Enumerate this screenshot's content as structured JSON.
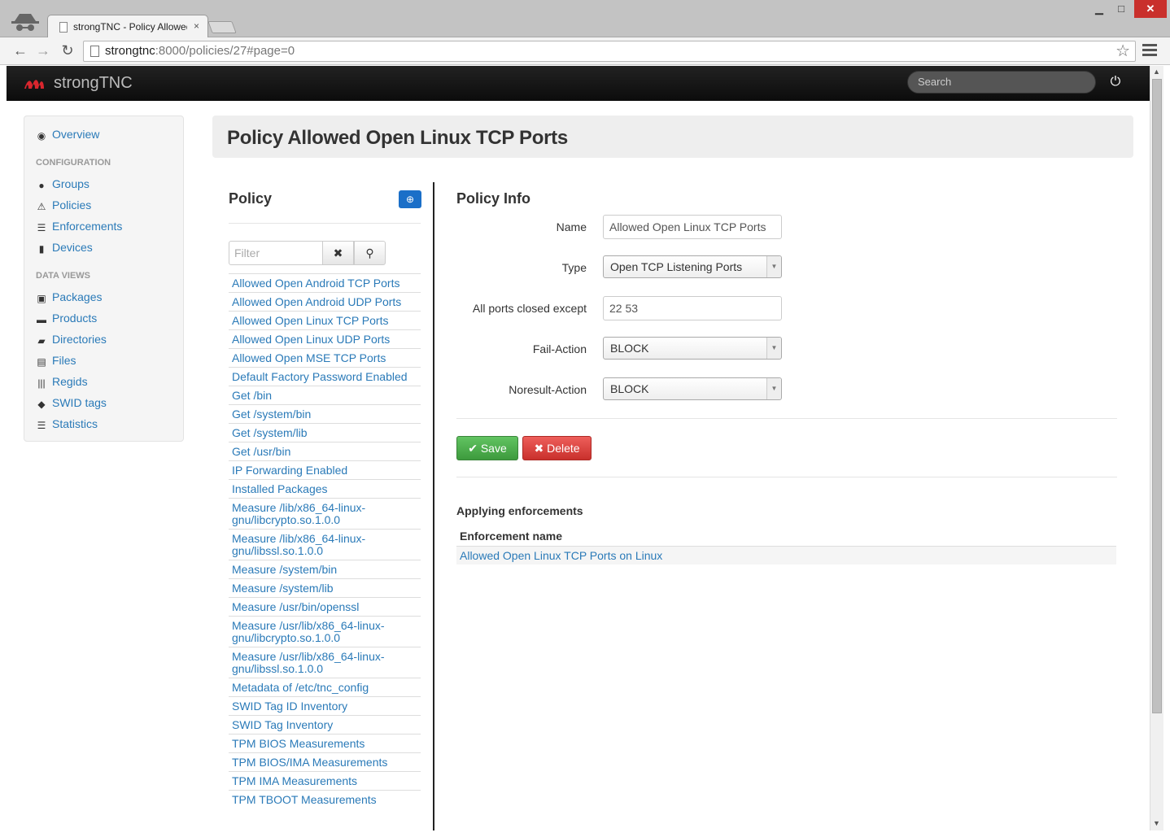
{
  "browser": {
    "tab_title": "strongTNC - Policy Allowed Open Linux TCP Ports",
    "tab_close": "×",
    "url_host": "strongtnc",
    "url_rest": ":8000/policies/27#page=0",
    "minimize": "▁",
    "maximize": "□",
    "close": "✕"
  },
  "navbar": {
    "brand": "strongTNC",
    "search_placeholder": "Search",
    "power_icon": "power-icon"
  },
  "sidebar": {
    "overview": "Overview",
    "configuration_header": "CONFIGURATION",
    "config_items": [
      {
        "label": "Groups",
        "icon": "user-icon"
      },
      {
        "label": "Policies",
        "icon": "warning-icon"
      },
      {
        "label": "Enforcements",
        "icon": "list-icon"
      },
      {
        "label": "Devices",
        "icon": "phone-icon"
      }
    ],
    "data_views_header": "DATA VIEWS",
    "data_items": [
      {
        "label": "Packages",
        "icon": "gift-icon"
      },
      {
        "label": "Products",
        "icon": "briefcase-icon"
      },
      {
        "label": "Directories",
        "icon": "folder-open-icon"
      },
      {
        "label": "Files",
        "icon": "file-icon"
      },
      {
        "label": "Regids",
        "icon": "barcode-icon"
      },
      {
        "label": "SWID tags",
        "icon": "tag-icon"
      },
      {
        "label": "Statistics",
        "icon": "tasks-icon"
      }
    ]
  },
  "page": {
    "title": "Policy Allowed Open Linux TCP Ports"
  },
  "policy_list": {
    "title": "Policy",
    "filter_placeholder": "Filter",
    "items": [
      "Allowed Open Android TCP Ports",
      "Allowed Open Android UDP Ports",
      "Allowed Open Linux TCP Ports",
      "Allowed Open Linux UDP Ports",
      "Allowed Open MSE TCP Ports",
      "Default Factory Password Enabled",
      "Get /bin",
      "Get /system/bin",
      "Get /system/lib",
      "Get /usr/bin",
      "IP Forwarding Enabled",
      "Installed Packages",
      "Measure /lib/x86_64-linux-gnu/libcrypto.so.1.0.0",
      "Measure /lib/x86_64-linux-gnu/libssl.so.1.0.0",
      "Measure /system/bin",
      "Measure /system/lib",
      "Measure /usr/bin/openssl",
      "Measure /usr/lib/x86_64-linux-gnu/libcrypto.so.1.0.0",
      "Measure /usr/lib/x86_64-linux-gnu/libssl.so.1.0.0",
      "Metadata of /etc/tnc_config",
      "SWID Tag ID Inventory",
      "SWID Tag Inventory",
      "TPM BIOS Measurements",
      "TPM BIOS/IMA Measurements",
      "TPM IMA Measurements",
      "TPM TBOOT Measurements"
    ]
  },
  "policy_info": {
    "title": "Policy Info",
    "name_label": "Name",
    "name_value": "Allowed Open Linux TCP Ports",
    "type_label": "Type",
    "type_value": "Open TCP Listening Ports",
    "ports_label": "All ports closed except",
    "ports_value": "22 53",
    "fail_label": "Fail-Action",
    "fail_value": "BLOCK",
    "noresult_label": "Noresult-Action",
    "noresult_value": "BLOCK",
    "save_label": "Save",
    "delete_label": "Delete"
  },
  "enforcements": {
    "title": "Applying enforcements",
    "column_header": "Enforcement name",
    "rows": [
      "Allowed Open Linux TCP Ports on Linux"
    ]
  }
}
